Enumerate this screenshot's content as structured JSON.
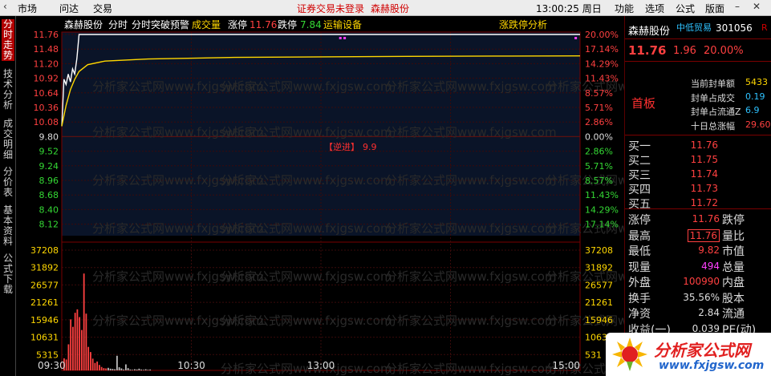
{
  "topbar": {
    "menu_market": "市场",
    "menu_wenda": "问达",
    "menu_trade": "交易",
    "status_left": "证券交易未登录",
    "status_stock": "森赫股份",
    "time": "13:00:25 周日",
    "menu_func": "功能",
    "menu_options": "选项",
    "menu_formula": "公式",
    "menu_layout": "版面"
  },
  "vtabs": [
    "分时走势",
    "技术分析",
    "成交明细",
    "分价表",
    "基本资料",
    "公式下载"
  ],
  "chart_header": {
    "name": "森赫股份",
    "mode": "分时",
    "alert": "分时突破预警",
    "vol_label": "成交量",
    "limit_up_label": "涨停",
    "limit_up_val": "11.76",
    "limit_down_label": "跌停",
    "limit_down_val": "7.84",
    "industry": "运输设备",
    "indicator": "涨跌停分析"
  },
  "annotation": {
    "label": "【逆进】",
    "value": "9.9"
  },
  "watermark": "分析家公式网www.fxjgsw.com",
  "chart_data": {
    "type": "line",
    "title": "森赫股份 分时",
    "prev_close": 9.8,
    "price_ticks": [
      "11.76",
      "11.48",
      "11.20",
      "10.92",
      "10.64",
      "10.36",
      "10.08",
      "9.80",
      "9.52",
      "9.24",
      "8.96",
      "8.68",
      "8.40",
      "8.12"
    ],
    "pct_ticks": [
      "20.00%",
      "17.14%",
      "14.29%",
      "11.43%",
      "8.57%",
      "5.71%",
      "2.86%",
      "0.00%",
      "2.86%",
      "5.71%",
      "8.57%",
      "11.43%",
      "14.29%",
      "17.14%"
    ],
    "volume_ticks": [
      "37208",
      "31892",
      "26577",
      "21261",
      "15946",
      "10631",
      "5315"
    ],
    "volume_ticks_right": [
      "37208",
      "31892",
      "26577",
      "21261",
      "15946",
      "10631",
      "531"
    ],
    "x_ticks": [
      "09:30",
      "10:30",
      "13:00",
      "15:00"
    ],
    "ylim": [
      7.84,
      11.76
    ],
    "volume_max": 42524,
    "series": [
      {
        "name": "price",
        "color": "#ffffff",
        "points": [
          [
            0,
            10.0
          ],
          [
            1,
            10.9
          ],
          [
            2,
            10.8
          ],
          [
            3,
            11.0
          ],
          [
            4,
            10.85
          ],
          [
            5,
            11.1
          ],
          [
            6,
            11.0
          ],
          [
            7,
            11.3
          ],
          [
            8,
            11.76
          ],
          [
            9,
            11.76
          ],
          [
            240,
            11.76
          ]
        ]
      },
      {
        "name": "avg",
        "color": "#ffd700",
        "points": [
          [
            0,
            10.0
          ],
          [
            2,
            10.4
          ],
          [
            4,
            10.7
          ],
          [
            6,
            10.9
          ],
          [
            8,
            11.05
          ],
          [
            12,
            11.18
          ],
          [
            20,
            11.25
          ],
          [
            40,
            11.29
          ],
          [
            80,
            11.32
          ],
          [
            120,
            11.33
          ],
          [
            160,
            11.34
          ],
          [
            200,
            11.345
          ],
          [
            240,
            11.35
          ]
        ]
      }
    ],
    "volumes": [
      4200,
      3800,
      9100,
      17800,
      15200,
      20100,
      21300,
      18600,
      14100,
      33800,
      19800,
      8200,
      6400,
      4100,
      2600,
      3100,
      1900,
      1200,
      800,
      700,
      900,
      600,
      500,
      400,
      5100,
      1100,
      700,
      300,
      2100,
      800,
      300,
      200,
      400,
      300,
      600,
      300,
      200,
      400,
      200,
      300
    ],
    "limit_up_markers": [
      [
        129,
        11.76
      ],
      [
        131,
        11.76
      ],
      [
        238,
        11.76
      ]
    ]
  },
  "quote": {
    "name": "森赫股份",
    "tag": "中低贸易",
    "code": "301056",
    "code_flag": "R",
    "price": "11.76",
    "change": "1.96",
    "pct": "20.00%",
    "shouban": "首板",
    "seal": [
      {
        "k": "当前封单额",
        "v": "5433",
        "color": "#ffd700"
      },
      {
        "k": "封单占成交",
        "v": "0.19",
        "color": "#2ec2ff"
      },
      {
        "k": "封单占流通Z",
        "v": "6.9",
        "color": "#2ec2ff"
      },
      {
        "k": "十日总涨幅",
        "v": "29.60",
        "color": "#ff4040"
      }
    ],
    "orderbook": [
      {
        "k": "买一",
        "v": "11.76"
      },
      {
        "k": "买二",
        "v": "11.75"
      },
      {
        "k": "买三",
        "v": "11.74"
      },
      {
        "k": "买四",
        "v": "11.73"
      },
      {
        "k": "买五",
        "v": "11.72"
      }
    ],
    "stats": [
      {
        "k": "涨停",
        "v": "11.76",
        "vcolor": "#ff4040",
        "k2": "跌停"
      },
      {
        "k": "最高",
        "v": "11.76",
        "vcolor": "#ff4040",
        "k2": "量比"
      },
      {
        "k": "最低",
        "v": "9.82",
        "vcolor": "#ff4040",
        "k2": "市值"
      },
      {
        "k": "现量",
        "v": "494",
        "vcolor": "#ff40ff",
        "k2": "总量"
      },
      {
        "k": "外盘",
        "v": "100990",
        "vcolor": "#ff4040",
        "k2": "内盘"
      },
      {
        "k": "换手",
        "v": "35.56%",
        "vcolor": "#ddd",
        "k2": "股本"
      },
      {
        "k": "净资",
        "v": "2.84",
        "vcolor": "#ddd",
        "k2": "流通"
      },
      {
        "k": "收益(一)",
        "v": "0.039",
        "vcolor": "#ddd",
        "k2": "PE(动)"
      }
    ]
  },
  "logo": {
    "title": "分析家公式网",
    "url": "www.fxjgsw.com"
  }
}
